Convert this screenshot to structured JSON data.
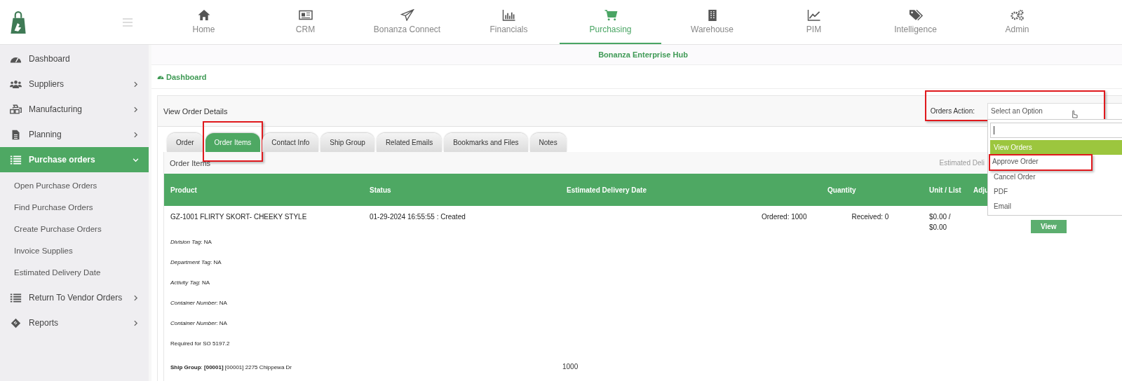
{
  "nav": [
    {
      "label": "Home",
      "selected": false
    },
    {
      "label": "CRM",
      "selected": false
    },
    {
      "label": "Bonanza Connect",
      "selected": false
    },
    {
      "label": "Financials",
      "selected": false
    },
    {
      "label": "Purchasing",
      "selected": true
    },
    {
      "label": "Warehouse",
      "selected": false
    },
    {
      "label": "PIM",
      "selected": false
    },
    {
      "label": "Intelligence",
      "selected": false
    },
    {
      "label": "Admin",
      "selected": false
    }
  ],
  "sidebar": {
    "items": [
      {
        "label": "Dashboard",
        "expandable": false,
        "selected": false
      },
      {
        "label": "Suppliers",
        "expandable": true,
        "selected": false
      },
      {
        "label": "Manufacturing",
        "expandable": true,
        "selected": false
      },
      {
        "label": "Planning",
        "expandable": true,
        "selected": false
      },
      {
        "label": "Purchase orders",
        "expandable": true,
        "selected": true,
        "children": [
          {
            "label": "Open Purchase Orders"
          },
          {
            "label": "Find Purchase Orders"
          },
          {
            "label": "Create Purchase Orders"
          },
          {
            "label": "Invoice Supplies"
          },
          {
            "label": "Estimated Delivery Date"
          }
        ]
      },
      {
        "label": "Return To Vendor Orders",
        "expandable": true,
        "selected": false
      },
      {
        "label": "Reports",
        "expandable": true,
        "selected": false
      }
    ]
  },
  "hub_title": "Bonanza Enterprise Hub",
  "breadcrumb": "Dashboard",
  "panel": {
    "title": "View Order Details",
    "orders_action": {
      "label": "Orders Action:",
      "placeholder": "Select an Option",
      "highlighted": true,
      "options": [
        {
          "label": "View Orders",
          "selected": true,
          "highlighted": false
        },
        {
          "label": "Approve Order",
          "selected": false,
          "highlighted": true
        },
        {
          "label": "Cancel Order",
          "selected": false,
          "highlighted": false
        },
        {
          "label": "PDF",
          "selected": false,
          "highlighted": false
        },
        {
          "label": "Email",
          "selected": false,
          "highlighted": false
        }
      ]
    },
    "tabs": [
      {
        "label": "Order",
        "selected": false,
        "highlighted": false
      },
      {
        "label": "Order Items",
        "selected": true,
        "highlighted": true
      },
      {
        "label": "Contact Info",
        "selected": false,
        "highlighted": false
      },
      {
        "label": "Ship Group",
        "selected": false,
        "highlighted": false
      },
      {
        "label": "Related Emails",
        "selected": false,
        "highlighted": false
      },
      {
        "label": "Bookmarks and Files",
        "selected": false,
        "highlighted": false
      },
      {
        "label": "Notes",
        "selected": false,
        "highlighted": false
      }
    ],
    "card": {
      "title": "Order Items",
      "side_label": "Estimated Deli",
      "columns": [
        "Product",
        "Status",
        "Estimated Delivery Date",
        "Quantity",
        "Unit / List",
        "Adju"
      ],
      "row": {
        "product": "GZ-1001  FLIRTY SKORT- CHEEKY STYLE",
        "status": "01-29-2024 16:55:55 : Created",
        "ordered": "Ordered:  1000",
        "received": "Received: 0",
        "unit": "$0.00 /",
        "list": "$0.00",
        "action": "View"
      },
      "details": [
        {
          "kind": "tag",
          "text": "*Division Tag*: NA"
        },
        {
          "kind": "tag",
          "text": "*Department Tag*: NA"
        },
        {
          "kind": "tag",
          "text": "*Activity Tag*: NA"
        },
        {
          "kind": "tag",
          "text": "*Container Number*: NA"
        },
        {
          "kind": "tag",
          "text": "*Container Number*: NA"
        },
        {
          "kind": "note",
          "text": "Required for SO 5197.2"
        },
        {
          "kind": "ship",
          "text": "**Ship Group**: **[00001]** [00001] 2275 Chippewa Dr",
          "quantity": "1000"
        }
      ]
    }
  }
}
